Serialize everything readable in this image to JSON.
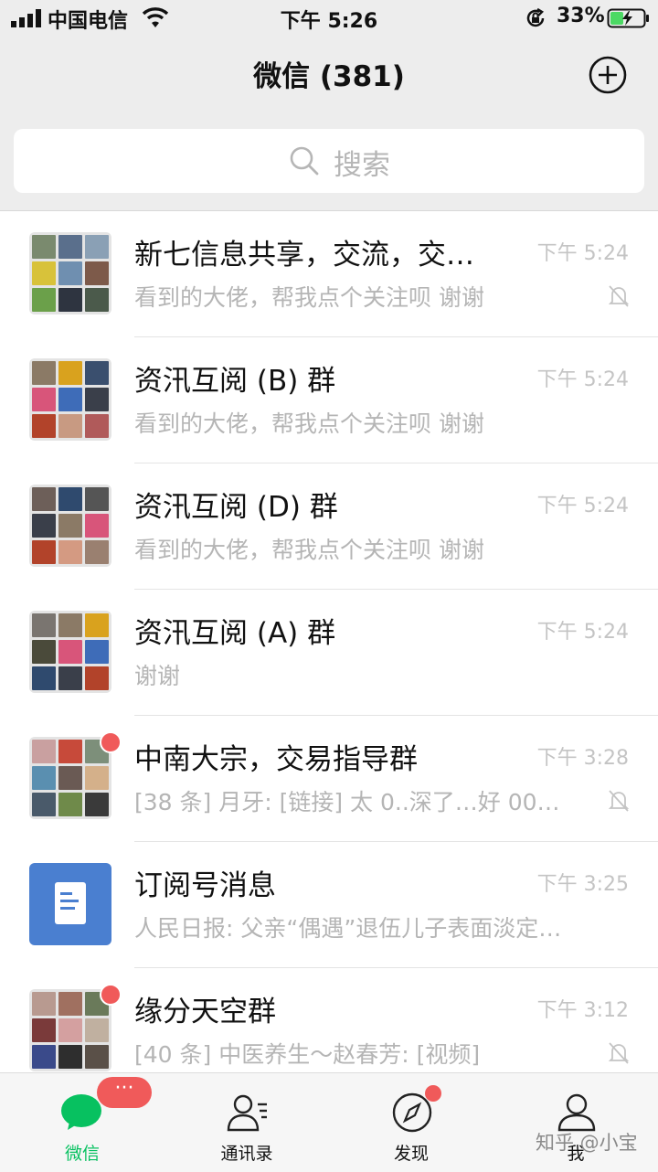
{
  "status_bar": {
    "carrier": "中国电信",
    "time": "下午 5:26",
    "battery_percent": "33%",
    "icons": [
      "signal-icon",
      "wifi-icon",
      "orientation-lock-icon",
      "battery-charging-icon"
    ]
  },
  "header": {
    "title": "微信 (381)",
    "add_icon": "plus-circle-icon"
  },
  "search": {
    "placeholder": "搜索",
    "icon": "search-icon"
  },
  "chats": [
    {
      "name": "新七信息共享，交流，交…",
      "preview": "看到的大佬，帮我点个关注呗  谢谢",
      "time": "下午 5:24",
      "muted": true,
      "unread_dot": false,
      "avatar": "group-avatar"
    },
    {
      "name": "资汛互阅 (B) 群",
      "preview": "看到的大佬，帮我点个关注呗  谢谢",
      "time": "下午 5:24",
      "muted": false,
      "unread_dot": false,
      "avatar": "group-avatar"
    },
    {
      "name": "资汛互阅 (D) 群",
      "preview": "看到的大佬，帮我点个关注呗  谢谢",
      "time": "下午 5:24",
      "muted": false,
      "unread_dot": false,
      "avatar": "group-avatar"
    },
    {
      "name": "资汛互阅 (A) 群",
      "preview": "谢谢",
      "time": "下午 5:24",
      "muted": false,
      "unread_dot": false,
      "avatar": "group-avatar"
    },
    {
      "name": "中南大宗，交易指导群",
      "preview": "[38 条] 月牙: [链接] 太 0..深了…好 00…",
      "time": "下午 3:28",
      "muted": true,
      "unread_dot": true,
      "avatar": "group-avatar"
    },
    {
      "name": "订阅号消息",
      "preview": "人民日报: 父亲“偶遇”退伍儿子表面淡定…",
      "time": "下午 3:25",
      "muted": false,
      "unread_dot": false,
      "avatar": "subscription-document-icon"
    },
    {
      "name": "缘分天空群",
      "preview": "[40 条] 中医养生～赵春芳: [视频]",
      "time": "下午 3:12",
      "muted": true,
      "unread_dot": true,
      "avatar": "group-avatar"
    }
  ],
  "tabs": [
    {
      "label": "微信",
      "icon": "chat-bubble-icon",
      "active": true,
      "badge": "···"
    },
    {
      "label": "通讯录",
      "icon": "contacts-icon",
      "active": false
    },
    {
      "label": "发现",
      "icon": "compass-icon",
      "active": false,
      "dot": true
    },
    {
      "label": "我",
      "icon": "person-icon",
      "active": false
    }
  ],
  "watermark": "知乎 @小宝",
  "colors": {
    "brand_green": "#07c160",
    "badge_red": "#f05a5a",
    "background": "#ededed",
    "subscription_blue": "#4a7fd0"
  }
}
